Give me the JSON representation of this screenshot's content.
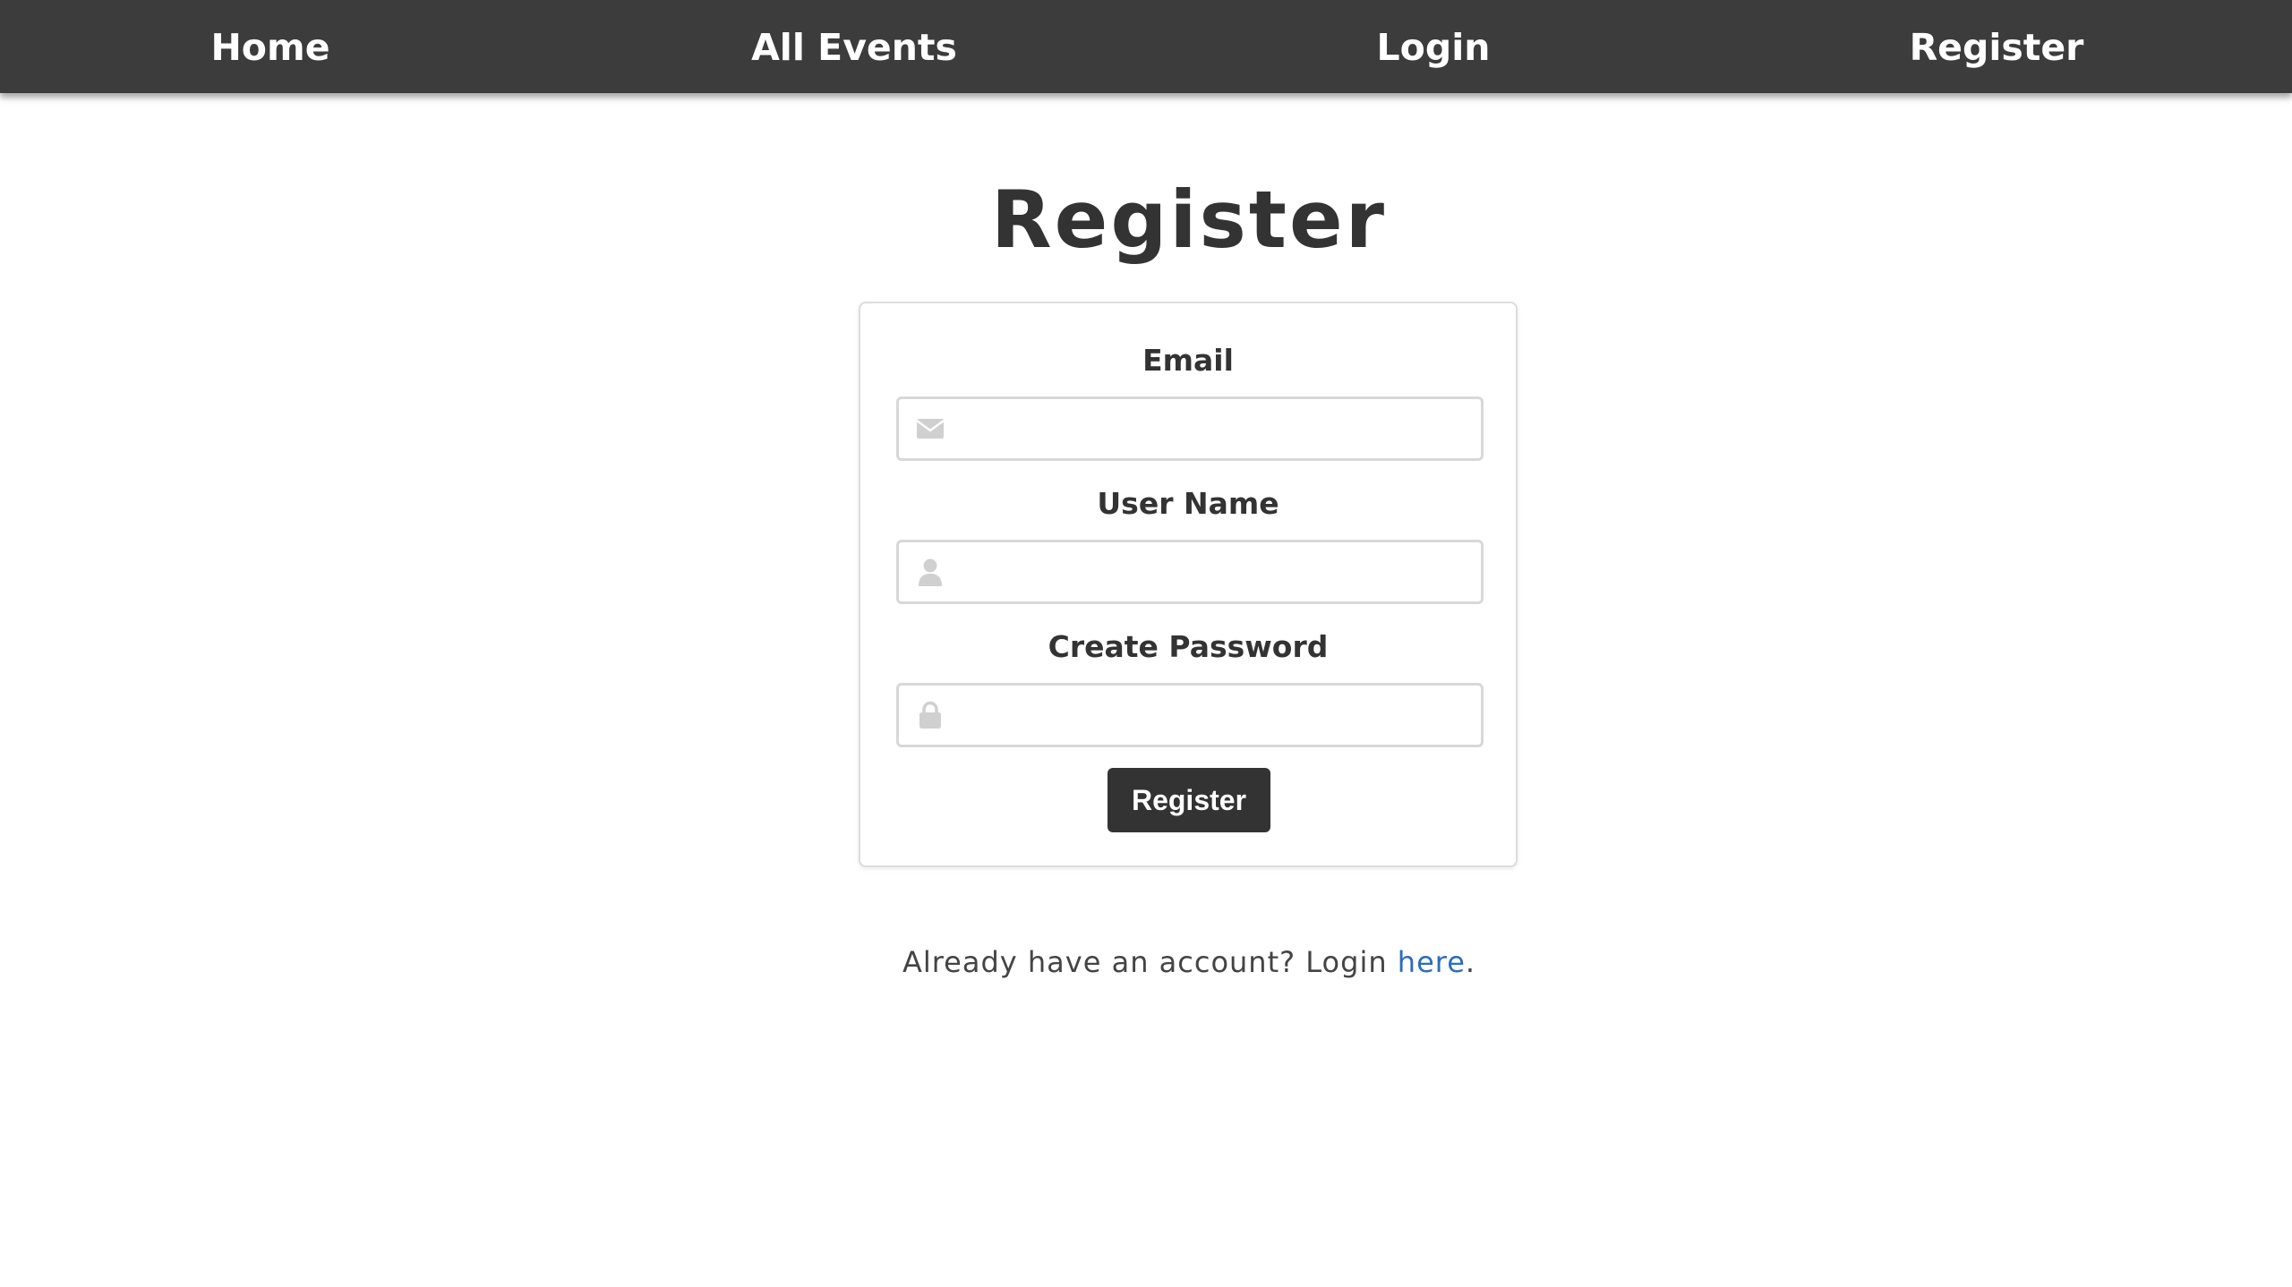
{
  "nav": {
    "items": [
      {
        "label": "Home"
      },
      {
        "label": "All Events"
      },
      {
        "label": "Login"
      },
      {
        "label": "Register"
      }
    ]
  },
  "page": {
    "title": "Register"
  },
  "form": {
    "email": {
      "label": "Email",
      "value": "",
      "placeholder": "",
      "icon": "envelope-icon"
    },
    "username": {
      "label": "User Name",
      "value": "",
      "placeholder": "",
      "icon": "user-icon"
    },
    "password": {
      "label": "Create Password",
      "value": "",
      "placeholder": "",
      "icon": "lock-icon"
    },
    "submit_label": "Register"
  },
  "footer": {
    "prefix": "Already have an account? Login ",
    "link_label": "here",
    "suffix": "."
  },
  "colors": {
    "navbar_bg": "#3c3c3c",
    "button_bg": "#333333",
    "link": "#2a6ebb",
    "icon": "#d0d0d0"
  }
}
